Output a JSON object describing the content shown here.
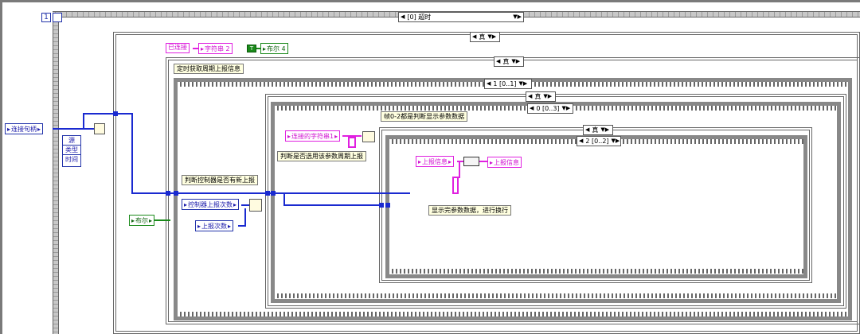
{
  "loop": {
    "index_label": "1"
  },
  "outer_case": {
    "selector": "[0] 超时"
  },
  "case_true_1": {
    "selector": "真"
  },
  "case_true_2": {
    "selector": "真"
  },
  "case_true_3": {
    "selector": "真"
  },
  "case_true_4": {
    "selector": "真"
  },
  "sequence_outer": {
    "frame": "1 [0..1]"
  },
  "sequence_mid": {
    "frame": "0 [0..3]"
  },
  "sequence_inner": {
    "frame": "2 [0..2]"
  },
  "labels": {
    "connected_text": "已连接",
    "string2": "字符串 2",
    "bool4": "布尔 4",
    "timed_report": "定时获取周期上报信息",
    "judge_new_report": "判断控制器是否有新上报",
    "frame_note": "帧0-2都是判断显示参数数据",
    "judge_selected": "判断是否选用该参数周期上报",
    "display_done": "显示完参数数据，进行换行"
  },
  "terminals": {
    "connection_handle": "连接句柄",
    "source": "源",
    "type": "类型",
    "time": "时间",
    "bool": "布尔",
    "controller_count": "控制器上报次数",
    "report_count": "上报次数",
    "connected_string1": "连接的字符串1",
    "report_info_in": "上报信息",
    "report_info_out": "上报信息",
    "true_const": "T",
    "index_const": "i"
  }
}
